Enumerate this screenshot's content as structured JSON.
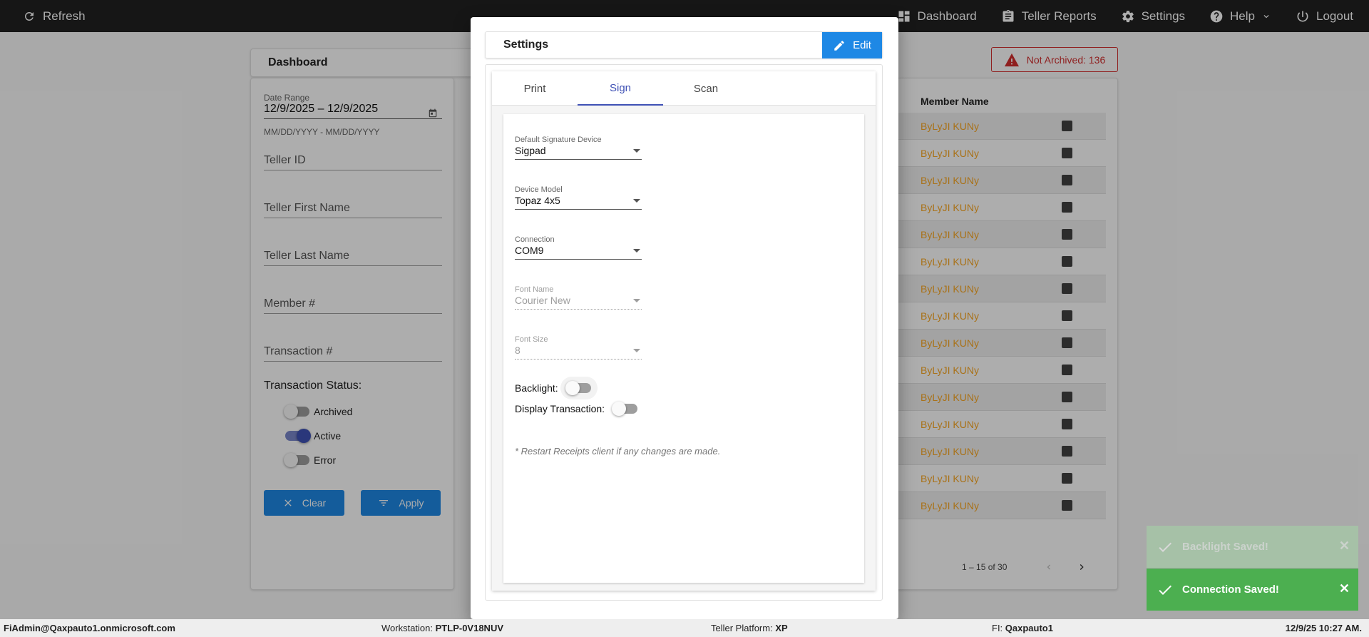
{
  "topbar": {
    "refresh_label": "Refresh",
    "nav": [
      {
        "label": "Dashboard",
        "icon": "dashboard-icon"
      },
      {
        "label": "Teller Reports",
        "icon": "clipboard-icon"
      },
      {
        "label": "Settings",
        "icon": "gear-icon"
      },
      {
        "label": "Help",
        "icon": "help-icon"
      },
      {
        "label": "Logout",
        "icon": "power-icon"
      }
    ]
  },
  "dashboard": {
    "title": "Dashboard",
    "not_archived": "Not Archived: 136",
    "filters": {
      "date_range_label": "Date Range",
      "date_range_value": "12/9/2025 – 12/9/2025",
      "date_hint": "MM/DD/YYYY - MM/DD/YYYY",
      "teller_id": "Teller ID",
      "teller_first_name": "Teller First Name",
      "teller_last_name": "Teller Last Name",
      "member_number": "Member #",
      "transaction_number": "Transaction #",
      "status_heading": "Transaction Status:",
      "statuses": [
        {
          "label": "Archived",
          "on": false
        },
        {
          "label": "Active",
          "on": true
        },
        {
          "label": "Error",
          "on": false
        }
      ],
      "clear_label": "Clear",
      "apply_label": "Apply"
    },
    "table": {
      "column_member_name": "Member Name",
      "rows": [
        "ByLyJI KUNy",
        "ByLyJI KUNy",
        "ByLyJI KUNy",
        "ByLyJI KUNy",
        "ByLyJI KUNy",
        "ByLyJI KUNy",
        "ByLyJI KUNy",
        "ByLyJI KUNy",
        "ByLyJI KUNy",
        "ByLyJI KUNy",
        "ByLyJI KUNy",
        "ByLyJI KUNy",
        "ByLyJI KUNy",
        "ByLyJI KUNy",
        "ByLyJI KUNy"
      ],
      "pager": "1 – 15 of 30"
    }
  },
  "dialog": {
    "title": "Settings",
    "edit_label": "Edit",
    "tabs": [
      "Print",
      "Sign",
      "Scan"
    ],
    "active_tab": "Sign",
    "sign": {
      "default_device_label": "Default Signature Device",
      "default_device_value": "Sigpad",
      "device_model_label": "Device Model",
      "device_model_value": "Topaz 4x5",
      "connection_label": "Connection",
      "connection_value": "COM9",
      "font_name_label": "Font Name",
      "font_name_value": "Courier New",
      "font_size_label": "Font Size",
      "font_size_value": "8",
      "backlight_label": "Backlight:",
      "backlight_on": false,
      "display_tx_label": "Display Transaction:",
      "display_tx_on": false,
      "note": "* Restart Receipts client if any changes are made."
    }
  },
  "toasts": [
    {
      "message": "Backlight Saved!",
      "faded": true
    },
    {
      "message": "Connection Saved!",
      "faded": false
    }
  ],
  "footer": {
    "user": "FiAdmin@Qaxpauto1.onmicrosoft.com",
    "workstation_label": "Workstation:",
    "workstation_value": "PTLP-0V18NUV",
    "platform_label": "Teller Platform:",
    "platform_value": "XP",
    "fi_label": "FI:",
    "fi_value": "Qaxpauto1",
    "datetime": "12/9/25 10:27 AM."
  },
  "colors": {
    "accent": "#1e88e5",
    "tab_active": "#3f51b5",
    "member_name": "#f9a825",
    "alert": "#d32f2f",
    "toast": "#4caf50"
  }
}
